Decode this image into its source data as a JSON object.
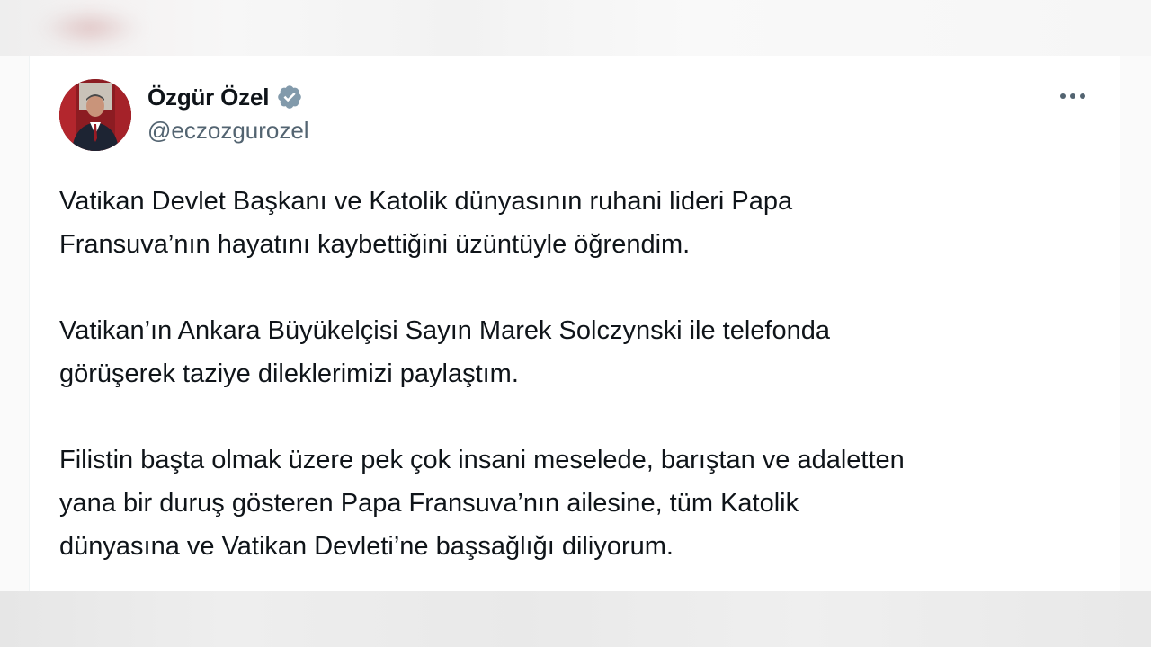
{
  "tweet": {
    "author": {
      "display_name": "Özgür Özel",
      "handle": "@eczozgurozel",
      "verified": true,
      "avatar_icon": "profile-photo",
      "verified_icon": "verified-badge-icon",
      "verified_color": "#829aab"
    },
    "more_icon": "more-horizontal-icon",
    "paragraphs": [
      "Vatikan Devlet Başkanı ve Katolik dünyasının ruhani lideri Papa\nFransuva’nın hayatını kaybettiğini üzüntüyle öğrendim.",
      "Vatikan’ın Ankara Büyükelçisi Sayın Marek Solczynski ile telefonda\ngörüşerek taziye dileklerimizi paylaştım.",
      "Filistin başta olmak üzere pek çok insani meselede, barıştan ve adaletten\nyana bir duruş gösteren Papa Fransuva’nın ailesine, tüm Katolik\ndünyasına ve Vatikan Devleti’ne başsağlığı diliyorum."
    ]
  },
  "colors": {
    "text_primary": "#0f1419",
    "text_secondary": "#536471",
    "card_background": "#ffffff"
  }
}
